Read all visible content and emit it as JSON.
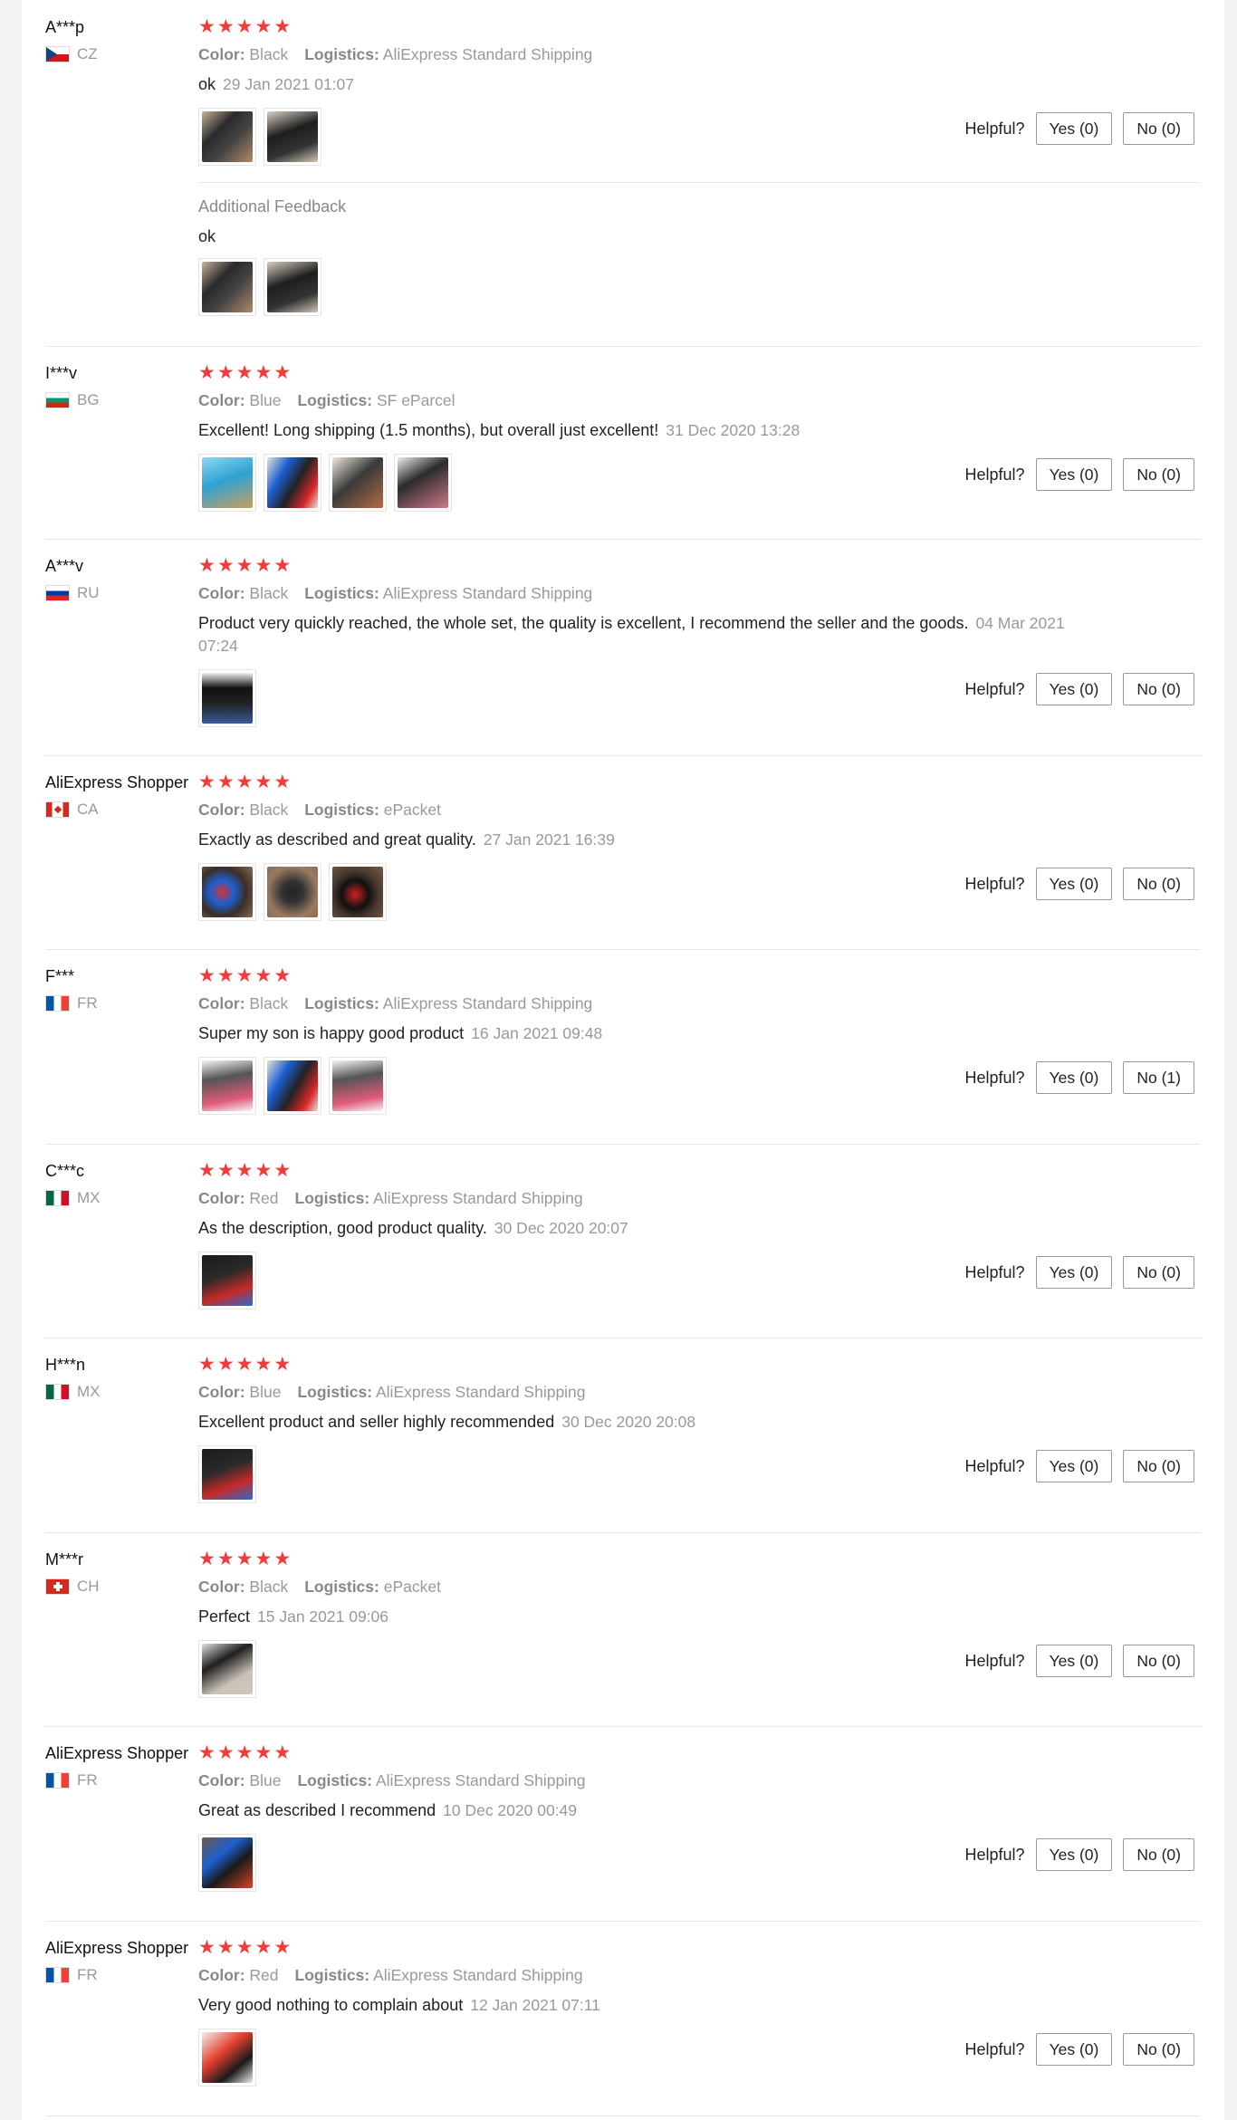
{
  "helpful_label": "Helpful?",
  "attr_labels": {
    "color": "Color:",
    "logistics": "Logistics:"
  },
  "star_color": "#f23b3b",
  "reviews": [
    {
      "user": "A***p",
      "country": "CZ",
      "flag": "cz",
      "rating": 5,
      "color": "Black",
      "logistics": "AliExpress Standard Shipping",
      "text": "ok",
      "date": "29 Jan 2021 01:07",
      "images": [
        "ph-case-dark",
        "ph-case-black"
      ],
      "yes": "Yes (0)",
      "no": "No (0)",
      "additional": {
        "title": "Additional Feedback",
        "text": "ok",
        "images": [
          "ph-case-dark",
          "ph-case-black"
        ]
      }
    },
    {
      "user": "I***v",
      "country": "BG",
      "flag": "bg",
      "rating": 5,
      "color": "Blue",
      "logistics": "SF eParcel",
      "text": "Excellent! Long shipping (1.5 months), but overall just excellent!",
      "date": "31 Dec 2020 13:28",
      "images": [
        "ph-blue",
        "ph-red-blue",
        "ph-cream",
        "ph-dark-pink"
      ],
      "yes": "Yes (0)",
      "no": "No (0)"
    },
    {
      "user": "A***v",
      "country": "RU",
      "flag": "ru",
      "rating": 5,
      "color": "Black",
      "logistics": "AliExpress Standard Shipping",
      "text": "Product very quickly reached, the whole set, the quality is excellent, I recommend the seller and the goods.",
      "date": "04 Mar 2021 07:24",
      "images": [
        "ph-phone"
      ],
      "yes": "Yes (0)",
      "no": "No (0)"
    },
    {
      "user": "AliExpress Shopper",
      "country": "CA",
      "flag": "ca",
      "rating": 5,
      "color": "Black",
      "logistics": "ePacket",
      "text": "Exactly as described and great quality.",
      "date": "27 Jan 2021 16:39",
      "images": [
        "ph-carpet",
        "ph-carpet2",
        "ph-carpet3"
      ],
      "yes": "Yes (0)",
      "no": "No (0)"
    },
    {
      "user": "F***",
      "country": "FR",
      "flag": "fr",
      "rating": 5,
      "color": "Black",
      "logistics": "AliExpress Standard Shipping",
      "text": "Super my son is happy good product",
      "date": "16 Jan 2021 09:48",
      "images": [
        "ph-pinkcase",
        "ph-red-blue",
        "ph-pinkcase"
      ],
      "yes": "Yes (0)",
      "no": "No (1)"
    },
    {
      "user": "C***c",
      "country": "MX",
      "flag": "mx",
      "rating": 5,
      "color": "Red",
      "logistics": "AliExpress Standard Shipping",
      "text": "As the description, good product quality.",
      "date": "30 Dec 2020 20:07",
      "images": [
        "ph-blackred"
      ],
      "yes": "Yes (0)",
      "no": "No (0)"
    },
    {
      "user": "H***n",
      "country": "MX",
      "flag": "mx",
      "rating": 5,
      "color": "Blue",
      "logistics": "AliExpress Standard Shipping",
      "text": "Excellent product and seller highly recommended",
      "date": "30 Dec 2020 20:08",
      "images": [
        "ph-blackred"
      ],
      "yes": "Yes (0)",
      "no": "No (0)"
    },
    {
      "user": "M***r",
      "country": "CH",
      "flag": "ch",
      "rating": 5,
      "color": "Black",
      "logistics": "ePacket",
      "text": "Perfect",
      "date": "15 Jan 2021 09:06",
      "images": [
        "ph-grey-kb"
      ],
      "yes": "Yes (0)",
      "no": "No (0)"
    },
    {
      "user": "AliExpress Shopper",
      "country": "FR",
      "flag": "fr",
      "rating": 5,
      "color": "Blue",
      "logistics": "AliExpress Standard Shipping",
      "text": "Great as described I recommend",
      "date": "10 Dec 2020 00:49",
      "images": [
        "ph-blue-case"
      ],
      "yes": "Yes (0)",
      "no": "No (0)"
    },
    {
      "user": "AliExpress Shopper",
      "country": "FR",
      "flag": "fr",
      "rating": 5,
      "color": "Red",
      "logistics": "AliExpress Standard Shipping",
      "text": "Very good nothing to complain about",
      "date": "12 Jan 2021 07:11",
      "images": [
        "ph-redcase"
      ],
      "yes": "Yes (0)",
      "no": "No (0)"
    }
  ]
}
